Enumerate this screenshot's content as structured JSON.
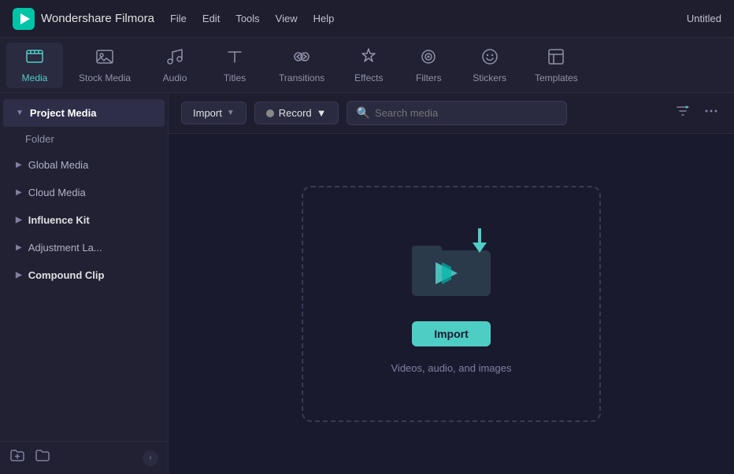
{
  "app": {
    "name": "Wondershare Filmora",
    "title": "Untitled"
  },
  "menu": {
    "items": [
      "File",
      "Edit",
      "Tools",
      "View",
      "Help"
    ]
  },
  "tabs": [
    {
      "id": "media",
      "label": "Media",
      "icon": "⊞",
      "active": true
    },
    {
      "id": "stock-media",
      "label": "Stock Media",
      "icon": "🎬"
    },
    {
      "id": "audio",
      "label": "Audio",
      "icon": "♪"
    },
    {
      "id": "titles",
      "label": "Titles",
      "icon": "T"
    },
    {
      "id": "transitions",
      "label": "Transitions",
      "icon": "↔"
    },
    {
      "id": "effects",
      "label": "Effects",
      "icon": "✦"
    },
    {
      "id": "filters",
      "label": "Filters",
      "icon": "◉"
    },
    {
      "id": "stickers",
      "label": "Stickers",
      "icon": "⬡"
    },
    {
      "id": "templates",
      "label": "Templates",
      "icon": "▦"
    }
  ],
  "sidebar": {
    "items": [
      {
        "id": "project-media",
        "label": "Project Media",
        "active": true,
        "hasArrow": true
      },
      {
        "id": "folder",
        "label": "Folder",
        "sub": true
      },
      {
        "id": "global-media",
        "label": "Global Media",
        "active": false,
        "hasArrow": true
      },
      {
        "id": "cloud-media",
        "label": "Cloud Media",
        "active": false,
        "hasArrow": true
      },
      {
        "id": "influence-kit",
        "label": "Influence Kit",
        "active": false,
        "hasArrow": true,
        "bold": true
      },
      {
        "id": "adjustment-la",
        "label": "Adjustment La...",
        "active": false,
        "hasArrow": true
      },
      {
        "id": "compound-clip",
        "label": "Compound Clip",
        "active": false,
        "hasArrow": true,
        "bold": true
      }
    ],
    "bottom": {
      "new_folder_label": "New folder",
      "new_bin_label": "New bin",
      "collapse_label": "Collapse"
    }
  },
  "toolbar": {
    "import_label": "Import",
    "record_label": "Record",
    "search_placeholder": "Search media",
    "filter_icon": "filter-icon",
    "more_icon": "more-icon"
  },
  "drop_zone": {
    "button_label": "Import",
    "description": "Videos, audio, and images"
  }
}
